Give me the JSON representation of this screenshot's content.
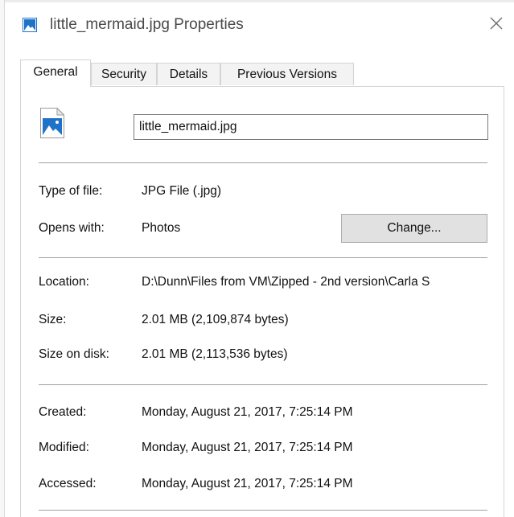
{
  "window": {
    "title": "little_mermaid.jpg Properties"
  },
  "tabs": [
    {
      "label": "General",
      "active": true
    },
    {
      "label": "Security",
      "active": false
    },
    {
      "label": "Details",
      "active": false
    },
    {
      "label": "Previous Versions",
      "active": false
    }
  ],
  "general": {
    "file_name": "little_mermaid.jpg",
    "type_label": "Type of file:",
    "type_value": "JPG File (.jpg)",
    "opens_label": "Opens with:",
    "opens_value": "Photos",
    "change_label": "Change...",
    "location_label": "Location:",
    "location_value": "D:\\Dunn\\Files from VM\\Zipped - 2nd version\\Carla S",
    "size_label": "Size:",
    "size_value": "2.01 MB (2,109,874 bytes)",
    "size_disk_label": "Size on disk:",
    "size_disk_value": "2.01 MB (2,113,536 bytes)",
    "created_label": "Created:",
    "created_value": "Monday, August 21, 2017, 7:25:14 PM",
    "modified_label": "Modified:",
    "modified_value": "Monday, August 21, 2017, 7:25:14 PM",
    "accessed_label": "Accessed:",
    "accessed_value": "Monday, August 21, 2017, 7:25:14 PM"
  },
  "icons": {
    "title": "image-file-icon",
    "close": "close-icon",
    "file": "image-file-icon"
  },
  "colors": {
    "icon_blue": "#1e73c8",
    "button_face": "#e1e1e1",
    "separator": "#a0a0a0"
  }
}
